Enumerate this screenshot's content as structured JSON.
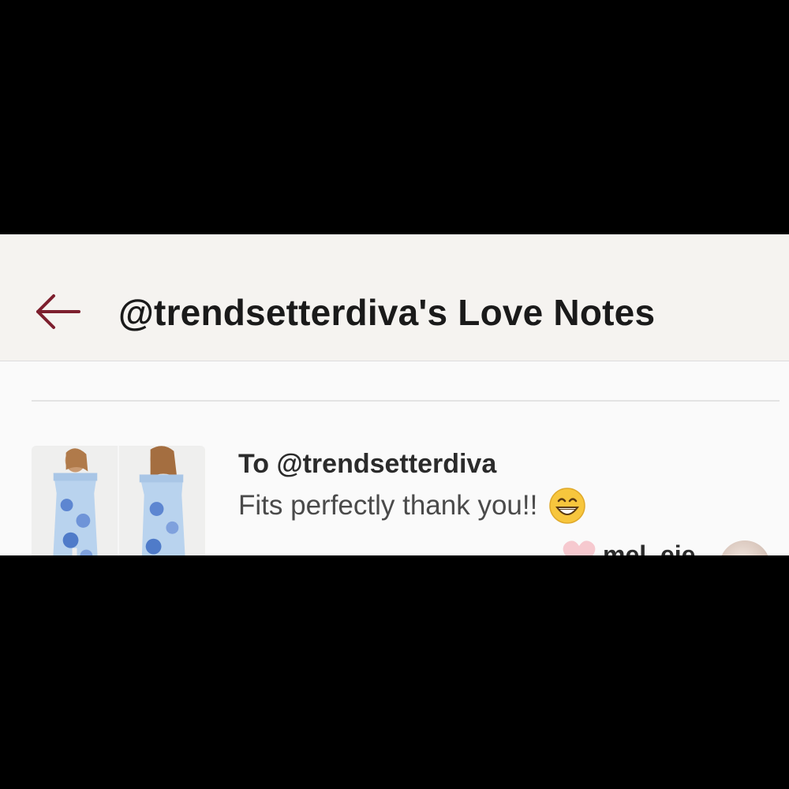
{
  "header": {
    "back_icon": "arrow-left-icon",
    "title": "@trendsetterdiva's Love Notes",
    "accent_color": "#7d1f2e",
    "background": "#f5f3f0"
  },
  "note": {
    "to_text": "To @trendsetterdiva",
    "message": "Fits perfectly thank you!!",
    "message_emoji": "grinning-face-emoji",
    "liked_icon": "heart-icon",
    "username": "mel_eie"
  }
}
